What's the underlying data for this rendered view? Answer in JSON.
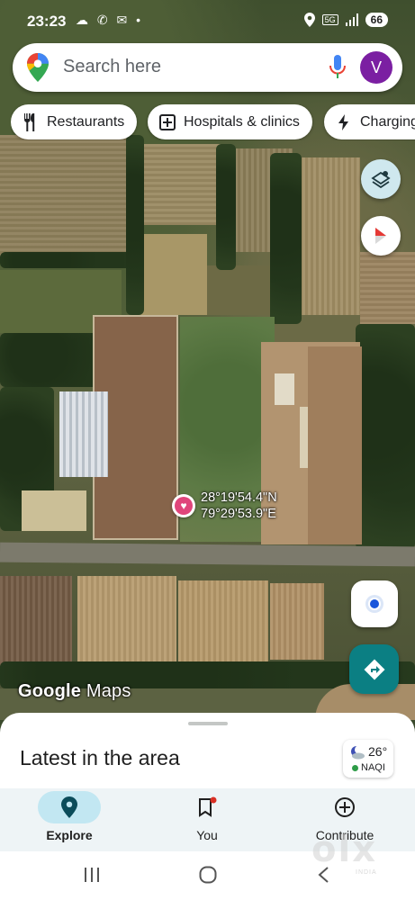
{
  "status_bar": {
    "time": "23:23",
    "left_icons": "☁ ✆ ✉ •",
    "signal_label": "5G",
    "battery": "66"
  },
  "search": {
    "placeholder": "Search here",
    "avatar_letter": "V"
  },
  "chips": [
    {
      "label": "Restaurants",
      "icon": "fork-knife-icon"
    },
    {
      "label": "Hospitals & clinics",
      "icon": "hospital-plus-icon"
    },
    {
      "label": "Charging",
      "icon": "bolt-icon"
    }
  ],
  "pin": {
    "lat": "28°19'54.4\"N",
    "lng": "79°29'53.9\"E",
    "icon": "heart-icon"
  },
  "map_logo": {
    "brand": "Google",
    "product": "Maps"
  },
  "sheet": {
    "title": "Latest in the area"
  },
  "weather": {
    "temp": "26°",
    "aqi_label": "NAQI",
    "aqi_color": "#2e9c48"
  },
  "bottom_nav": [
    {
      "label": "Explore",
      "icon": "pin-icon",
      "active": true
    },
    {
      "label": "You",
      "icon": "bookmark-icon",
      "active": false
    },
    {
      "label": "Contribute",
      "icon": "plus-circle-icon",
      "active": false
    }
  ],
  "watermark": {
    "text": "olx",
    "sub": "INDIA"
  },
  "colors": {
    "accent": "#0b7f83",
    "avatar": "#7b1fa2",
    "nav_pill": "#c2e7f2",
    "location_blue": "#1a56db",
    "pin": "#e0457b"
  }
}
